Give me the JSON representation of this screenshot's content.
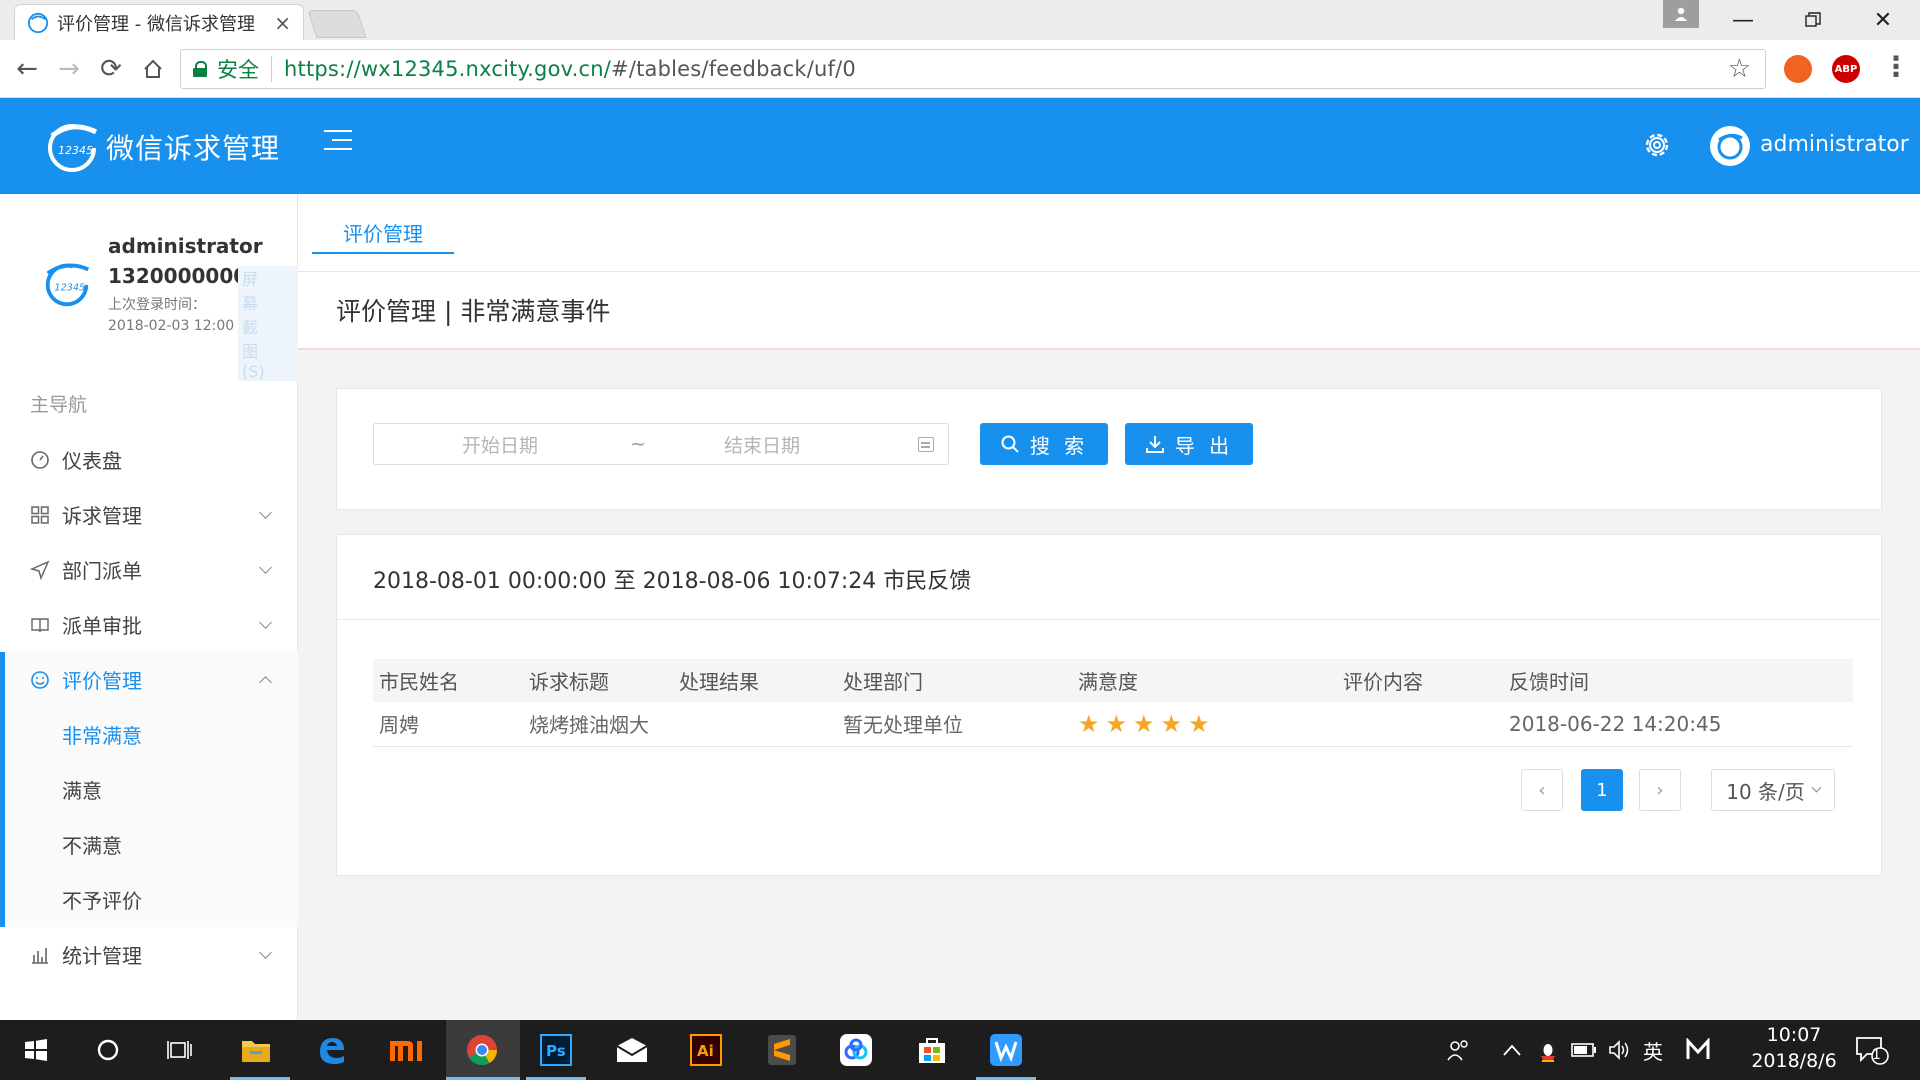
{
  "browser": {
    "tab_title": "评价管理 - 微信诉求管理",
    "tab_close": "×",
    "secure_label": "安全",
    "url_host": "https://wx12345.nxcity.gov.cn/",
    "url_path": "#/tables/feedback/uf/0",
    "ext_abp": "ABP"
  },
  "app": {
    "title": "微信诉求管理",
    "username": "administrator",
    "accent_color": "#1890ee"
  },
  "sidebar": {
    "user_name": "administrator",
    "user_phone": "13200000000",
    "ghost_text": "屏幕截图(S)",
    "login_label": "上次登录时间：",
    "login_time": "2018-02-03 12:00",
    "section_label": "主导航",
    "items": [
      {
        "label": "仪表盘",
        "icon": "dashboard-icon"
      },
      {
        "label": "诉求管理",
        "icon": "grid-icon"
      },
      {
        "label": "部门派单",
        "icon": "send-icon"
      },
      {
        "label": "派单审批",
        "icon": "book-icon"
      },
      {
        "label": "评价管理",
        "icon": "smile-icon"
      },
      {
        "label": "统计管理",
        "icon": "bar-chart-icon"
      }
    ],
    "sub_items": [
      "非常满意",
      "满意",
      "不满意",
      "不予评价"
    ]
  },
  "main": {
    "tab_label": "评价管理",
    "heading": "评价管理 | 非常满意事件",
    "filter": {
      "start_placeholder": "开始日期",
      "separator": "~",
      "end_placeholder": "结束日期",
      "search_label": "搜 索",
      "export_label": "导 出"
    },
    "result_title": "2018-08-01 00:00:00 至 2018-08-06 10:07:24 市民反馈",
    "table": {
      "columns": [
        "市民姓名",
        "诉求标题",
        "处理结果",
        "处理部门",
        "满意度",
        "评价内容",
        "反馈时间"
      ],
      "rows": [
        {
          "name": "周娉",
          "title": "烧烤摊油烟大",
          "result": "",
          "dept": "暂无处理单位",
          "rating": 5,
          "content": "",
          "time": "2018-06-22 14:20:45"
        }
      ]
    },
    "pagination": {
      "prev": "‹",
      "current": "1",
      "next": "›",
      "page_size": "10 条/页"
    }
  },
  "taskbar": {
    "ime": "英",
    "time": "10:07",
    "date": "2018/8/6",
    "notify_count": "1"
  }
}
